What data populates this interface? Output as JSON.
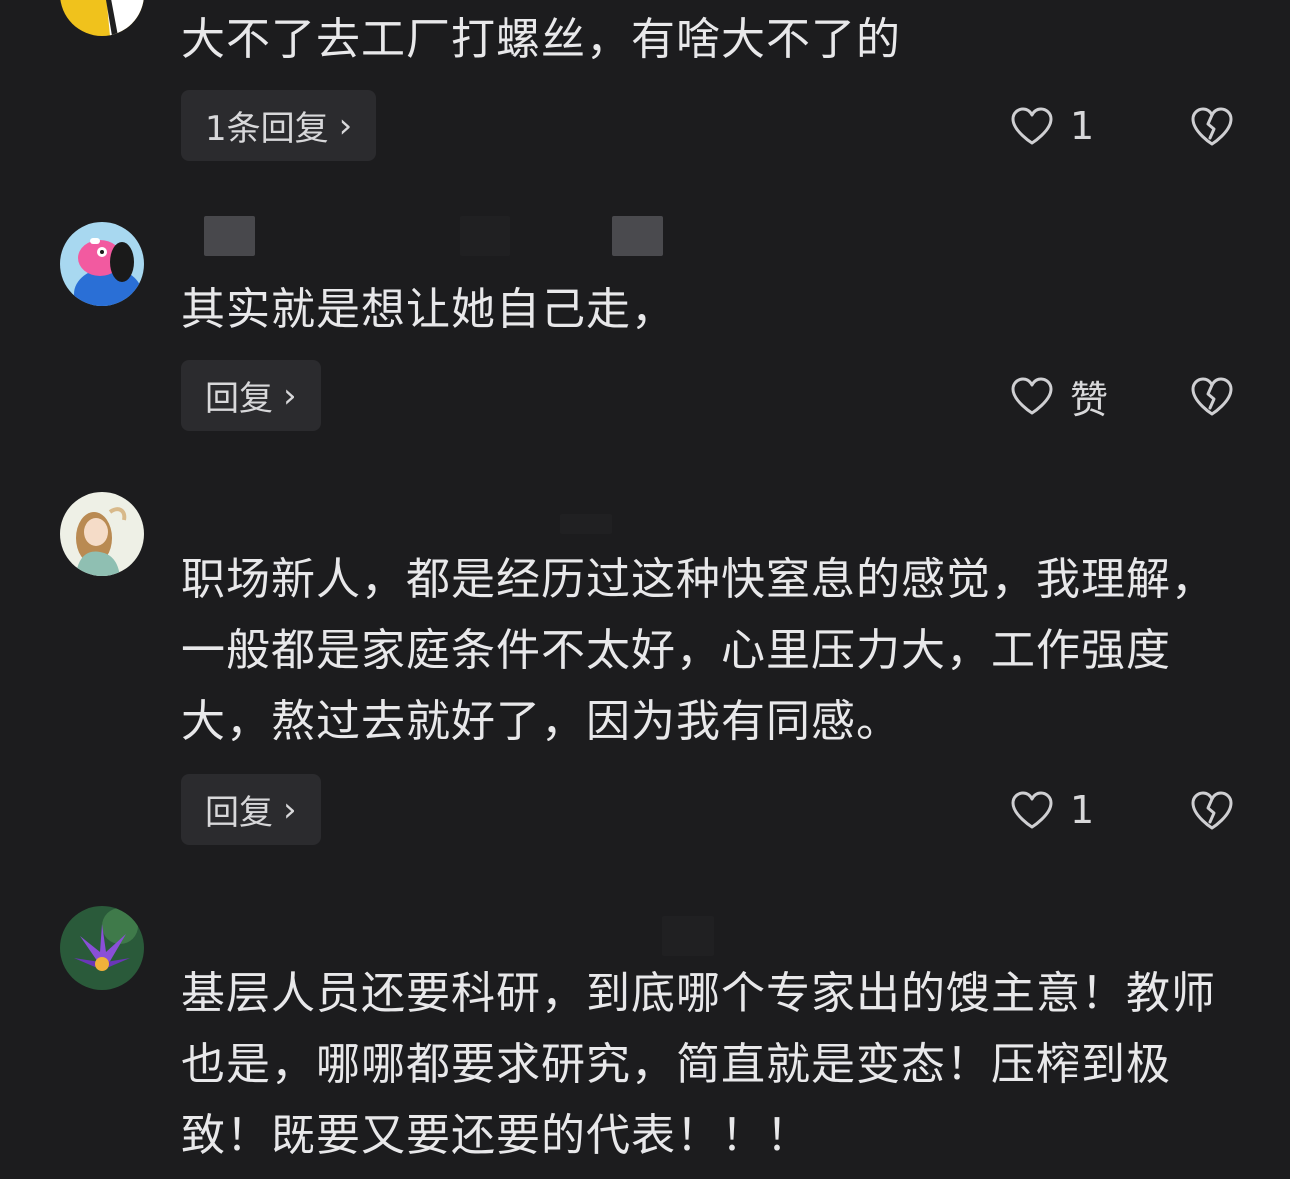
{
  "comments": [
    {
      "text": "大不了去工厂打螺丝，有啥大不了的",
      "reply_label": "1条回复",
      "like_label": "1"
    },
    {
      "text": "其实就是想让她自己走，",
      "reply_label": "回复",
      "like_label": "赞"
    },
    {
      "text": "职场新人，都是经历过这种快窒息的感觉，我理解，一般都是家庭条件不太好，心里压力大，工作强度大，熬过去就好了，因为我有同感。",
      "reply_label": "回复",
      "like_label": "1"
    },
    {
      "text": "基层人员还要科研，到底哪个专家出的馊主意！教师也是，哪哪都要求研究，简直就是变态！压榨到极致！既要又要还要的代表！！！"
    }
  ],
  "icons": {
    "like": "heart-outline-icon",
    "dislike": "broken-heart-icon",
    "reply_chevron": "chevron-right-icon"
  },
  "colors": {
    "background": "#1c1c1e",
    "text": "#e8e8ea",
    "reply_button_bg": "#2b2b2e"
  }
}
